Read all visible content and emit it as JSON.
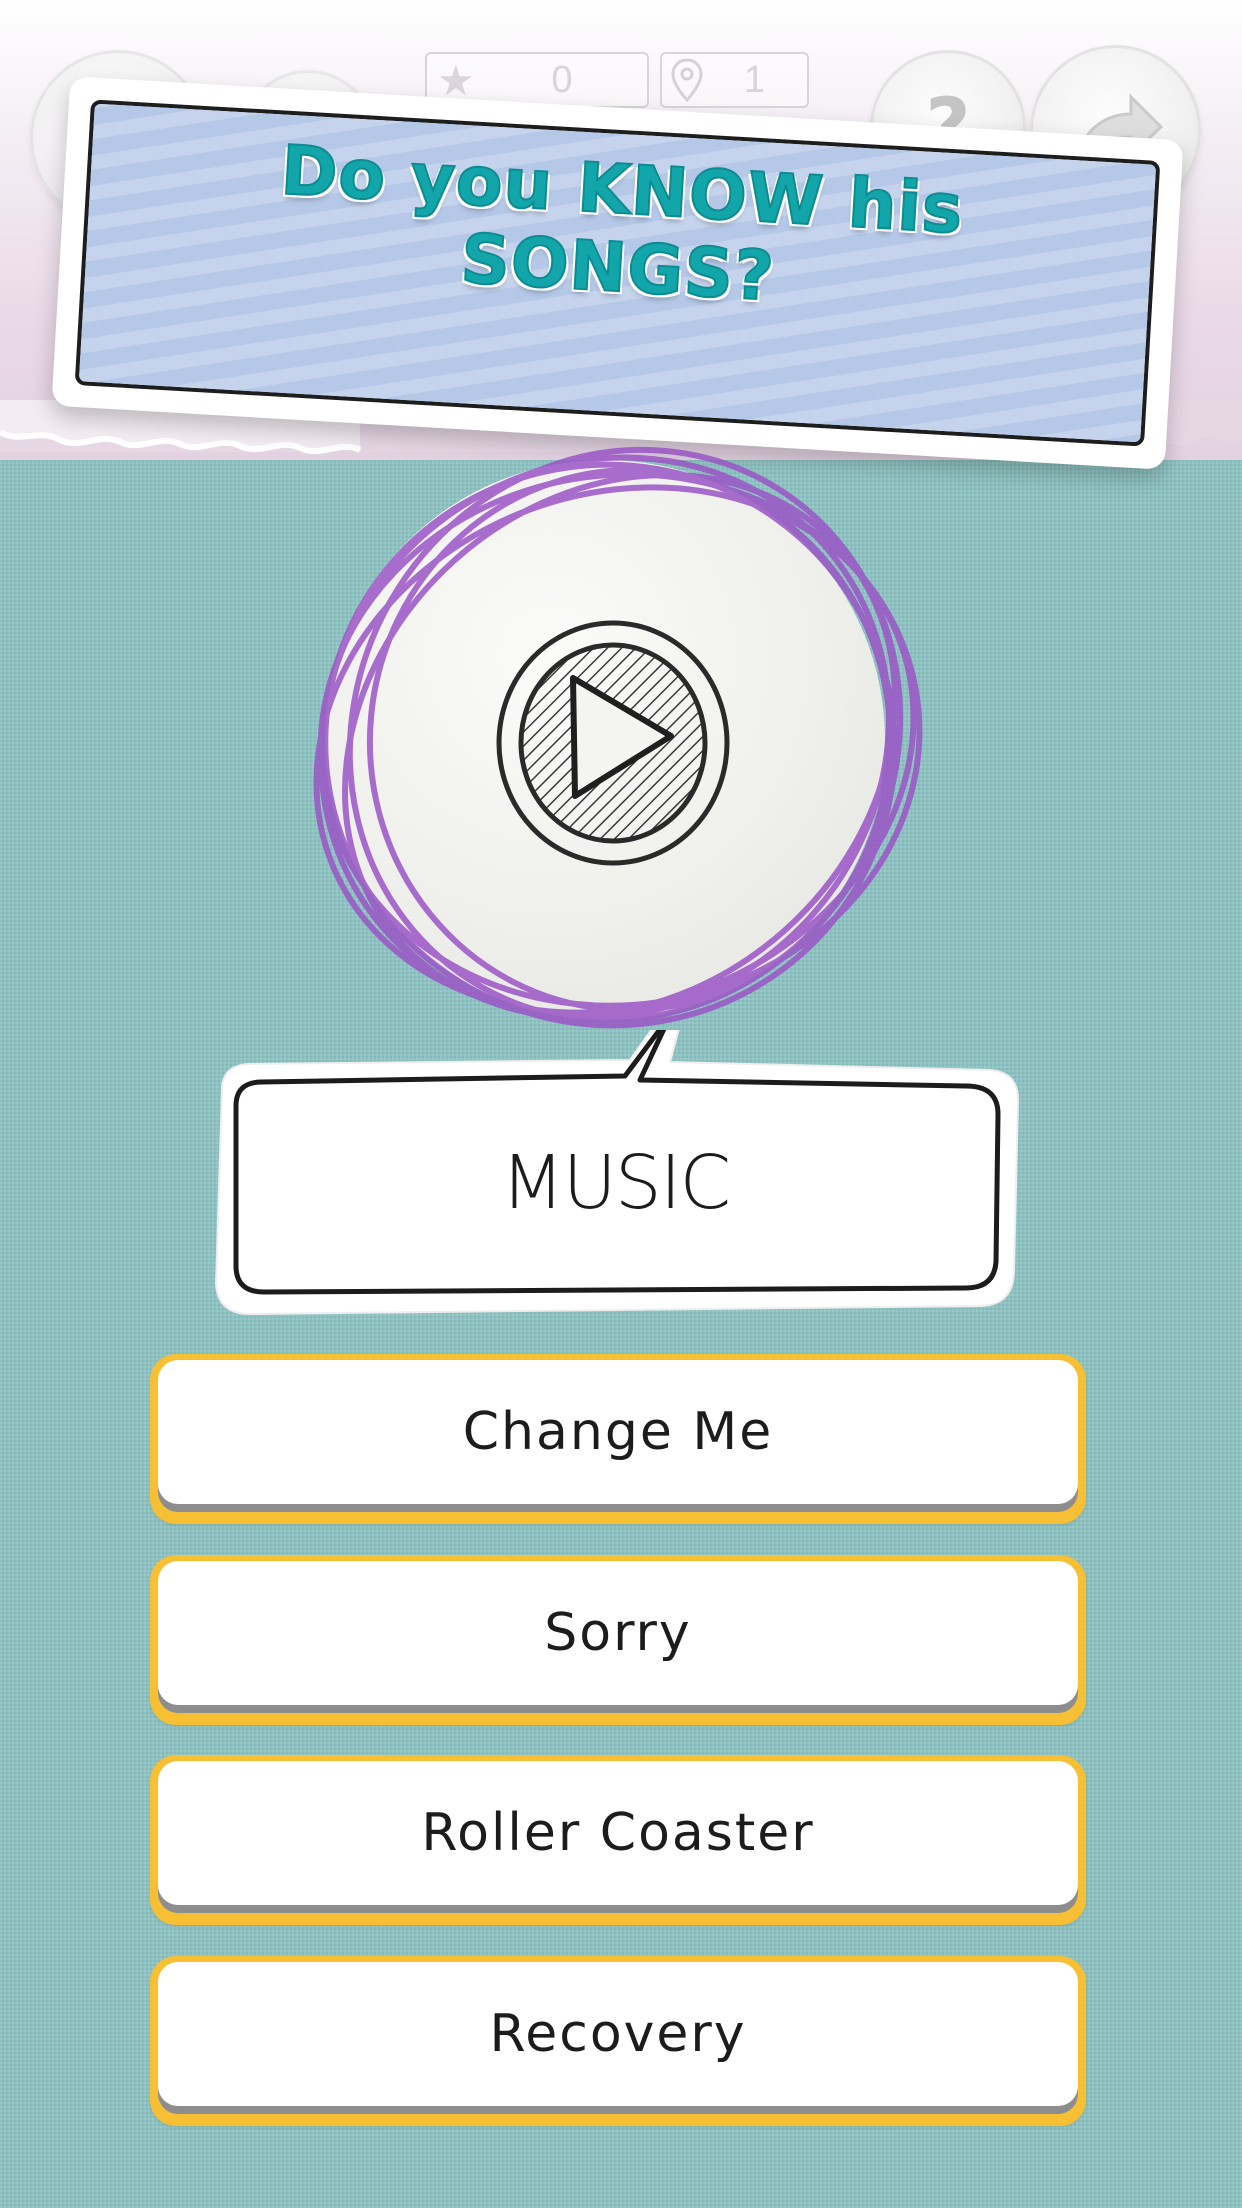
{
  "header": {
    "title": "Do you KNOW his SONGS?",
    "stars": "0",
    "level": "1"
  },
  "icons": {
    "star": "star-icon",
    "location": "location-pin-icon",
    "help": "question-icon",
    "share": "share-arrow-icon",
    "play": "play-icon"
  },
  "question": {
    "category": "MUSIC"
  },
  "answers": [
    {
      "label": "Change Me"
    },
    {
      "label": "Sorry"
    },
    {
      "label": "Roller Coaster"
    },
    {
      "label": "Recovery"
    }
  ],
  "colors": {
    "background": "#8cc3c2",
    "title_text": "#12a6ab",
    "scribble": "#c2d1ec",
    "answer_border": "#f7bf33",
    "disc_scribble": "#9a55c6"
  }
}
